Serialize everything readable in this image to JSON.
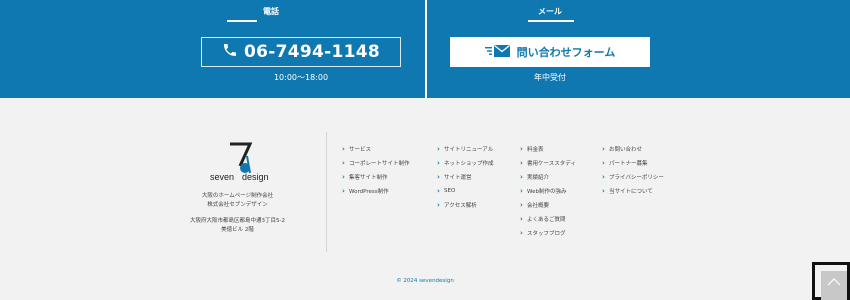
{
  "contact": {
    "tel": {
      "title": "電話",
      "number": "06-7494-1148",
      "hours": "10:00〜18:00",
      "icon": "phone-icon"
    },
    "mail": {
      "title": "メール",
      "button_label": "問い合わせフォーム",
      "note": "年中受付",
      "icon": "mail-icon"
    }
  },
  "brand": {
    "logo_text": "seven design",
    "company_line1": "大阪のホームページ制作会社",
    "company_line2": "株式会社セブンデザイン",
    "address_line1": "大阪府大阪市都島区都島中通3丁目5-2",
    "address_line2": "美徳ビル 2階"
  },
  "nav": {
    "col1": [
      "サービス",
      "コーポレートサイト制作",
      "集客サイト制作",
      "WordPress制作"
    ],
    "col2": [
      "サイトリニューアル",
      "ネットショップ作成",
      "サイト運営",
      "SEO",
      "アクセス解析"
    ],
    "col3": [
      "料金表",
      "書用ケーススタディ",
      "実績紹介",
      "Web制作の強み",
      "会社概要",
      "よくあるご質問",
      "スタッフブログ"
    ],
    "col4": [
      "お問い合わせ",
      "パートナー募集",
      "プライバシーポリシー",
      "当サイトについて"
    ]
  },
  "copyright": "© 2024 sevendesign",
  "colors": {
    "brand_blue": "#0f78b1",
    "footer_bg": "#f2f2f2"
  }
}
